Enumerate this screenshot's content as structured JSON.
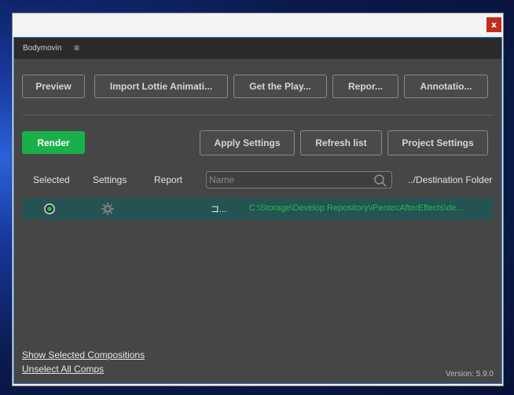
{
  "window": {
    "close_glyph": "x"
  },
  "panel": {
    "title": "Bodymovin",
    "menu_icon": "≡",
    "top_buttons": [
      {
        "label": "Preview"
      },
      {
        "label": "Import Lottie Animati..."
      },
      {
        "label": "Get the Play..."
      },
      {
        "label": "Repor..."
      },
      {
        "label": "Annotatio..."
      }
    ],
    "render_label": "Render",
    "action_buttons": [
      {
        "label": "Apply Settings"
      },
      {
        "label": "Refresh list"
      },
      {
        "label": "Project Settings"
      }
    ],
    "columns": {
      "selected": "Selected",
      "settings": "Settings",
      "report": "Report",
      "destination": "../Destination Folder"
    },
    "search": {
      "placeholder": "Name",
      "value": ""
    },
    "compositions": [
      {
        "selected": true,
        "report_glyph": "コ...",
        "destination": "C:\\Storage\\Develop Repository\\iPentecAfterEffects\\de..."
      }
    ],
    "links": {
      "show_selected": "Show Selected Compositions",
      "unselect_all": "Unselect All Comps"
    },
    "version": "Version: 5.9.0"
  },
  "colors": {
    "render_green": "#19b04a",
    "row_teal": "#255252",
    "path_green": "#1dbf4c",
    "panel_bg": "#464646",
    "header_bg": "#2b2b2b"
  }
}
